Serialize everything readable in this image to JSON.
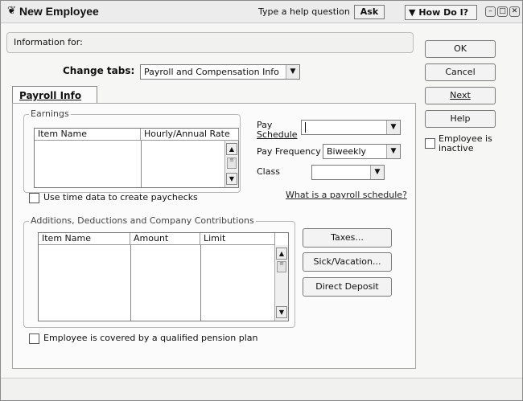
{
  "window": {
    "title": "New Employee",
    "help_placeholder": "Type a help question",
    "ask_label": "Ask",
    "how_do_label": "How Do I?"
  },
  "info_for": "Information for:",
  "change_tabs": {
    "label": "Change tabs:",
    "selected": "Payroll and Compensation Info"
  },
  "right_buttons": {
    "ok": "OK",
    "cancel": "Cancel",
    "next": "Next",
    "help": "Help"
  },
  "inactive_checkbox": {
    "label_line1": "Employee is",
    "label_line2": "inactive"
  },
  "tab_label": "Payroll Info",
  "earnings": {
    "legend": "Earnings",
    "col_item": "Item Name",
    "col_rate": "Hourly/Annual Rate"
  },
  "pay_schedule": {
    "label_line1": "Pay",
    "label_line2": "Schedule",
    "value": ""
  },
  "pay_frequency": {
    "label": "Pay Frequency",
    "value": "Biweekly"
  },
  "class_field": {
    "label": "Class",
    "value": ""
  },
  "time_data": "Use time data to create paychecks",
  "schedule_link": "What is a payroll schedule?",
  "additions": {
    "legend": "Additions, Deductions and Company Contributions",
    "col_item": "Item Name",
    "col_amount": "Amount",
    "col_limit": "Limit"
  },
  "side_buttons": {
    "taxes": "Taxes...",
    "sick": "Sick/Vacation...",
    "deposit": "Direct Deposit"
  },
  "pension": "Employee is covered by a qualified pension plan"
}
